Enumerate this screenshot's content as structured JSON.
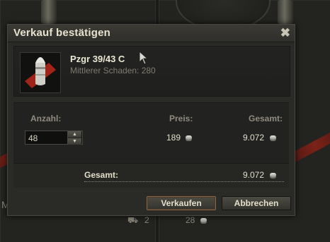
{
  "background": {
    "partial_text": "M",
    "slot_count_left": "2",
    "slot_count_right": "28"
  },
  "dialog": {
    "title": "Verkauf bestätigen",
    "close_glyph": "✖",
    "item": {
      "name": "Pzgr 39/43 C",
      "subtitle": "Mittlerer Schaden: 280"
    },
    "form": {
      "quantity_label": "Anzahl:",
      "price_label": "Preis:",
      "total_label": "Gesamt:",
      "quantity_value": "48",
      "price_value": "189",
      "row_total_value": "9.072"
    },
    "summary": {
      "label": "Gesamt:",
      "value": "9.072"
    },
    "buttons": {
      "sell": "Verkaufen",
      "cancel": "Abbrechen"
    }
  },
  "icons": {
    "currency": "silver-coin-icon",
    "item": "shell-icon"
  },
  "colors": {
    "accent": "#8a6a45",
    "shell_red": "#b0271a"
  }
}
